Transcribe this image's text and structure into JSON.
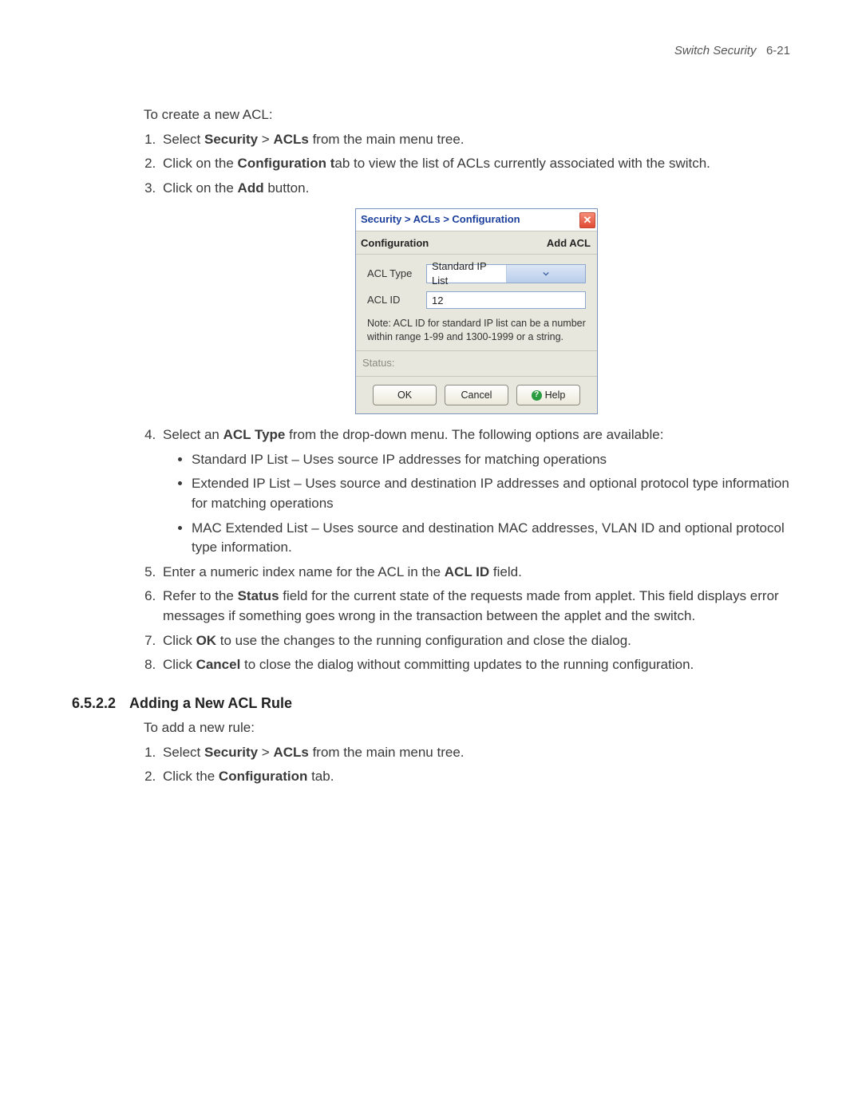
{
  "header": {
    "title": "Switch Security",
    "page": "6-21"
  },
  "section1": {
    "intro": "To create a new ACL:",
    "step1": {
      "pre": "Select ",
      "b1": "Security",
      "mid": " > ",
      "b2": "ACLs",
      "post": " from the main menu tree."
    },
    "step2": {
      "pre": "Click on the ",
      "b": "Configuration t",
      "post": "ab to view the list of ACLs currently associated with the switch."
    },
    "step3": {
      "pre": "Click on the ",
      "b": "Add",
      "post": " button."
    },
    "step4": {
      "pre": "Select an ",
      "b": "ACL Type",
      "post": " from the drop-down menu. The following options are available:",
      "bul1": "Standard IP List – Uses source IP addresses for matching operations",
      "bul2": "Extended IP List – Uses source and destination IP addresses and optional protocol type information for matching operations",
      "bul3": "MAC Extended List – Uses source and destination MAC addresses, VLAN ID and optional protocol type information."
    },
    "step5": {
      "pre": "Enter a numeric index name for the ACL in the ",
      "b": "ACL ID",
      "post": " field."
    },
    "step6": {
      "pre": "Refer to the ",
      "b": "Status",
      "post": " field for the current state of the requests made from applet. This field displays error messages if something goes wrong in the transaction between the applet and the switch."
    },
    "step7": {
      "pre": "Click ",
      "b": "OK",
      "post": " to use the changes to the running configuration and close the dialog."
    },
    "step8": {
      "pre": "Click ",
      "b": "Cancel",
      "post": " to close the dialog without committing updates to the running configuration."
    }
  },
  "dialog": {
    "breadcrumb": "Security > ACLs > Configuration",
    "tab": "Configuration",
    "title_right": "Add ACL",
    "acl_type_label": "ACL Type",
    "acl_type_value": "Standard IP List",
    "acl_id_label": "ACL ID",
    "acl_id_value": "12",
    "note": "Note: ACL ID for standard IP list can be a number within range 1-99 and 1300-1999 or a string.",
    "status_label": "Status:",
    "ok": "OK",
    "cancel": "Cancel",
    "help": "Help"
  },
  "section2": {
    "num": "6.5.2.2",
    "title": "Adding a New ACL Rule",
    "intro": "To add a new rule:",
    "step1": {
      "pre": "Select ",
      "b1": "Security",
      "mid": " > ",
      "b2": "ACLs",
      "post": " from the main menu tree."
    },
    "step2": {
      "pre": "Click the ",
      "b": "Configuration",
      "post": " tab."
    }
  }
}
